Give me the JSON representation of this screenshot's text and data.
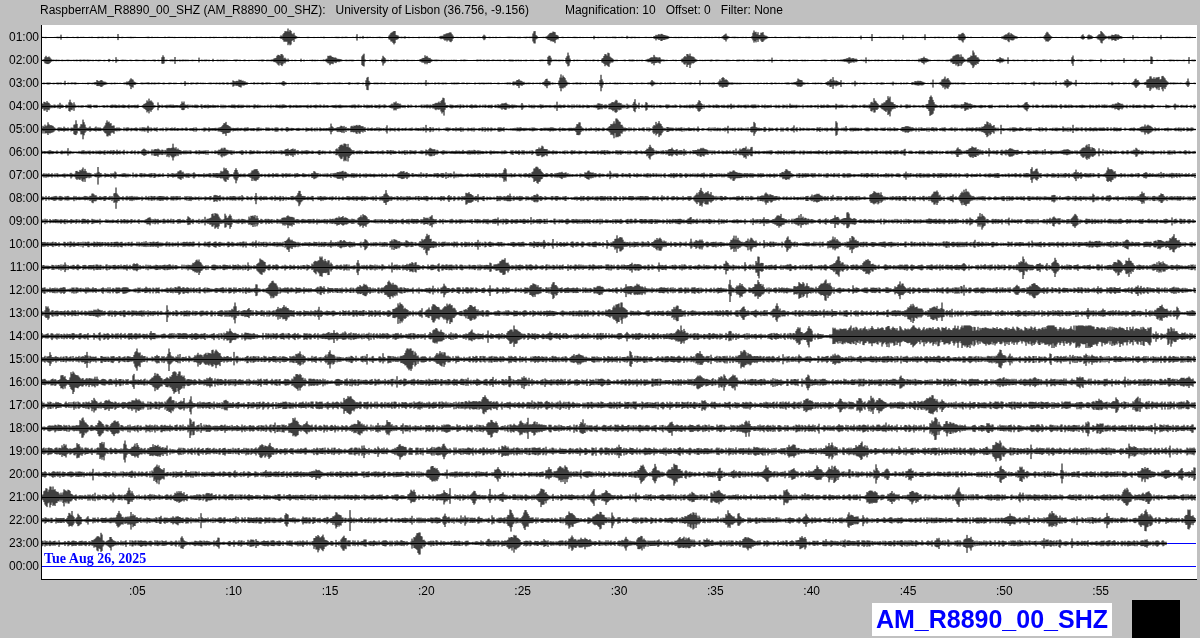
{
  "header": {
    "station": "RaspberrAM_R8890_00_SHZ (AM_R8890_00_SHZ):",
    "location": "University of Lisbon (36.756, -9.156)",
    "magnification": "Magnification: 10",
    "offset": "Offset: 0",
    "filter": "Filter: None"
  },
  "rows": [
    {
      "label": "01:00",
      "kind": "trace"
    },
    {
      "label": "02:00",
      "kind": "trace"
    },
    {
      "label": "03:00",
      "kind": "trace"
    },
    {
      "label": "04:00",
      "kind": "trace"
    },
    {
      "label": "05:00",
      "kind": "trace"
    },
    {
      "label": "06:00",
      "kind": "trace"
    },
    {
      "label": "07:00",
      "kind": "trace"
    },
    {
      "label": "08:00",
      "kind": "trace"
    },
    {
      "label": "09:00",
      "kind": "trace"
    },
    {
      "label": "10:00",
      "kind": "trace"
    },
    {
      "label": "11:00",
      "kind": "trace"
    },
    {
      "label": "12:00",
      "kind": "trace"
    },
    {
      "label": "13:00",
      "kind": "trace"
    },
    {
      "label": "14:00",
      "kind": "trace"
    },
    {
      "label": "15:00",
      "kind": "trace"
    },
    {
      "label": "16:00",
      "kind": "trace"
    },
    {
      "label": "17:00",
      "kind": "trace"
    },
    {
      "label": "18:00",
      "kind": "trace"
    },
    {
      "label": "19:00",
      "kind": "trace"
    },
    {
      "label": "20:00",
      "kind": "trace"
    },
    {
      "label": "21:00",
      "kind": "trace"
    },
    {
      "label": "22:00",
      "kind": "trace"
    },
    {
      "label": "23:00",
      "kind": "partial"
    },
    {
      "label": "00:00",
      "kind": "current",
      "date": "Tue Aug 26, 2025"
    }
  ],
  "ticks": [
    ":05",
    ":10",
    ":15",
    ":20",
    ":25",
    ":30",
    ":35",
    ":40",
    ":45",
    ":50",
    ":55"
  ],
  "channel_label": "AM_R8890_00_SHZ"
}
